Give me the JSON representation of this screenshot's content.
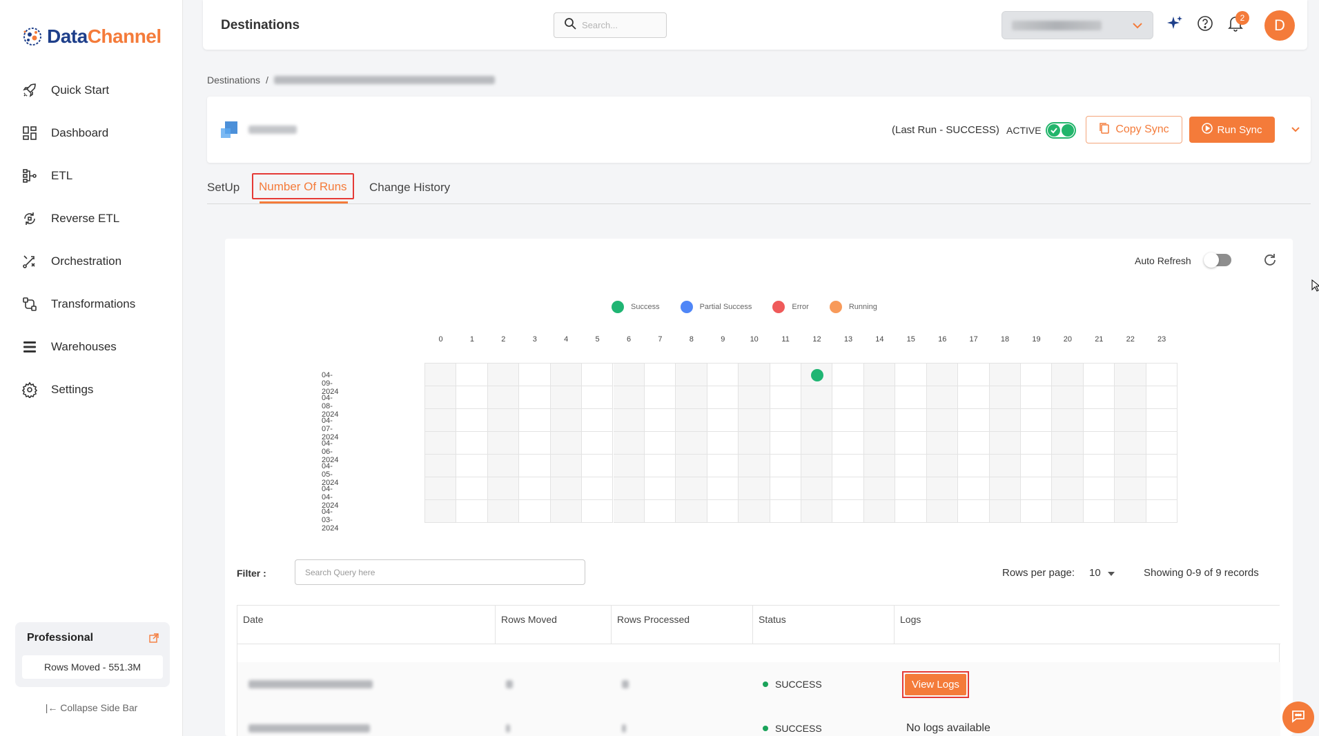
{
  "brand": {
    "name_part1": "Data",
    "name_part2": "Channel"
  },
  "sidebar": {
    "items": [
      {
        "label": "Quick Start",
        "icon": "rocket-icon"
      },
      {
        "label": "Dashboard",
        "icon": "dashboard-icon"
      },
      {
        "label": "ETL",
        "icon": "etl-icon"
      },
      {
        "label": "Reverse ETL",
        "icon": "reverse-etl-icon"
      },
      {
        "label": "Orchestration",
        "icon": "orchestration-icon"
      },
      {
        "label": "Transformations",
        "icon": "transformations-icon"
      },
      {
        "label": "Warehouses",
        "icon": "warehouses-icon"
      },
      {
        "label": "Settings",
        "icon": "gear-icon"
      }
    ],
    "plan": {
      "title": "Professional",
      "rows_moved": "Rows Moved - 551.3M"
    },
    "collapse_label": "Collapse Side Bar"
  },
  "header": {
    "title": "Destinations",
    "search_placeholder": "Search...",
    "notification_count": "2",
    "avatar_letter": "D"
  },
  "breadcrumb": {
    "root": "Destinations",
    "separator": "/"
  },
  "destination": {
    "last_run": "(Last Run - SUCCESS)",
    "active_label": "ACTIVE",
    "copy_sync_label": "Copy Sync",
    "run_sync_label": "Run Sync"
  },
  "tabs": [
    {
      "label": "SetUp",
      "active": false
    },
    {
      "label": "Number Of Runs",
      "active": true
    },
    {
      "label": "Change History",
      "active": false
    }
  ],
  "runs": {
    "auto_refresh_label": "Auto Refresh",
    "legend": [
      {
        "label": "Success",
        "color": "#1fb573"
      },
      {
        "label": "Partial Success",
        "color": "#4f86f7"
      },
      {
        "label": "Error",
        "color": "#ef5a5a"
      },
      {
        "label": "Running",
        "color": "#f89a5a"
      }
    ],
    "hours": [
      "0",
      "1",
      "2",
      "3",
      "4",
      "5",
      "6",
      "7",
      "8",
      "9",
      "10",
      "11",
      "12",
      "13",
      "14",
      "15",
      "16",
      "17",
      "18",
      "19",
      "20",
      "21",
      "22",
      "23"
    ],
    "dates": [
      "04-09-2024",
      "04-08-2024",
      "04-07-2024",
      "04-06-2024",
      "04-05-2024",
      "04-04-2024",
      "04-03-2024"
    ],
    "run_points": [
      {
        "date": "04-09-2024",
        "hour": 12,
        "status": "Success"
      }
    ]
  },
  "filter": {
    "label": "Filter :",
    "placeholder": "Search Query here"
  },
  "pagination": {
    "rows_per_page_label": "Rows per page:",
    "rows_per_page": "10",
    "records": "Showing 0-9 of 9 records"
  },
  "table": {
    "columns": [
      "Date",
      "Rows Moved",
      "Rows Processed",
      "Status",
      "Logs"
    ],
    "rows": [
      {
        "status": "SUCCESS",
        "logs": "View Logs"
      },
      {
        "status": "SUCCESS",
        "logs": "No logs available"
      }
    ]
  },
  "colors": {
    "accent": "#f47b3a",
    "brand_blue": "#1e3f8a",
    "success": "#1aa35a",
    "highlight": "#e53935"
  }
}
